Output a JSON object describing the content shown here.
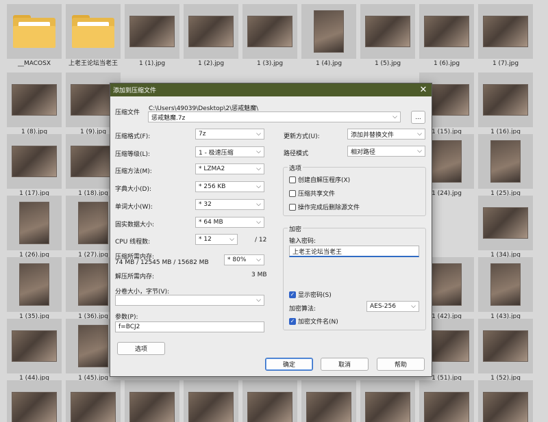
{
  "explorer": {
    "row1": [
      "__MACOSX",
      "上老王论坛当老王",
      "1 (1).jpg",
      "1 (2).jpg",
      "1 (3).jpg",
      "1 (4).jpg",
      "1 (5).jpg",
      "1 (6).jpg",
      "1 (7).jpg"
    ],
    "row2": [
      "1 (8).jpg",
      "1 (9).jpg",
      "1 (15).jpg",
      "1 (16).jpg"
    ],
    "row3": [
      "1 (17).jpg",
      "1 (18).jpg",
      "1 (24).jpg",
      "1 (25).jpg"
    ],
    "row4": [
      "1 (26).jpg",
      "1 (27).jpg",
      "1 (34).jpg"
    ],
    "row5": [
      "1 (35).jpg",
      "1 (36).jpg",
      "1 (42).jpg",
      "1 (43).jpg"
    ],
    "row6": [
      "1 (44).jpg",
      "1 (45).jpg",
      "1 (51).jpg",
      "1 (52).jpg"
    ]
  },
  "dialog": {
    "title": "添加到压缩文件",
    "archive_label": "压缩文件",
    "archive_path": "C:\\Users\\49039\\Desktop\\2\\惩戒魅魔\\",
    "archive_name": "惩戒魅魔.7z",
    "browse_label": "...",
    "left": {
      "format_label": "压缩格式(F):",
      "format_value": "7z",
      "level_label": "压缩等级(L):",
      "level_value": "1 - 极速压缩",
      "method_label": "压缩方法(M):",
      "method_value": "* LZMA2",
      "dict_label": "字典大小(D):",
      "dict_value": "* 256 KB",
      "word_label": "单词大小(W):",
      "word_value": "* 32",
      "solid_label": "固实数据大小:",
      "solid_value": "* 64 MB",
      "cpu_label": "CPU 线程数:",
      "cpu_value": "* 12",
      "cpu_total": "/ 12",
      "mem_label": "压缩所需内存:",
      "mem_detail": "74 MB / 12545 MB / 15682 MB",
      "mem_percent": "* 80%",
      "decomp_label": "解压所需内存:",
      "decomp_value": "3 MB",
      "split_label": "分卷大小，字节(V):",
      "split_value": "",
      "params_label": "参数(P):",
      "params_value": "f=BCJ2",
      "options_button": "选项"
    },
    "right": {
      "update_label": "更新方式(U):",
      "update_value": "添加并替换文件",
      "path_label": "路径模式",
      "path_value": "相对路径",
      "options_group": "选项",
      "opt_sfx": "创建自解压程序(X)",
      "opt_shared": "压缩共享文件",
      "opt_delete": "操作完成后删除源文件",
      "encrypt_group": "加密",
      "password_label": "输入密码:",
      "password_value": "上老王论坛当老王",
      "show_password": "显示密码(S)",
      "algo_label": "加密算法:",
      "algo_value": "AES-256",
      "encrypt_names": "加密文件名(N)"
    },
    "buttons": {
      "ok": "确定",
      "cancel": "取消",
      "help": "帮助"
    }
  }
}
